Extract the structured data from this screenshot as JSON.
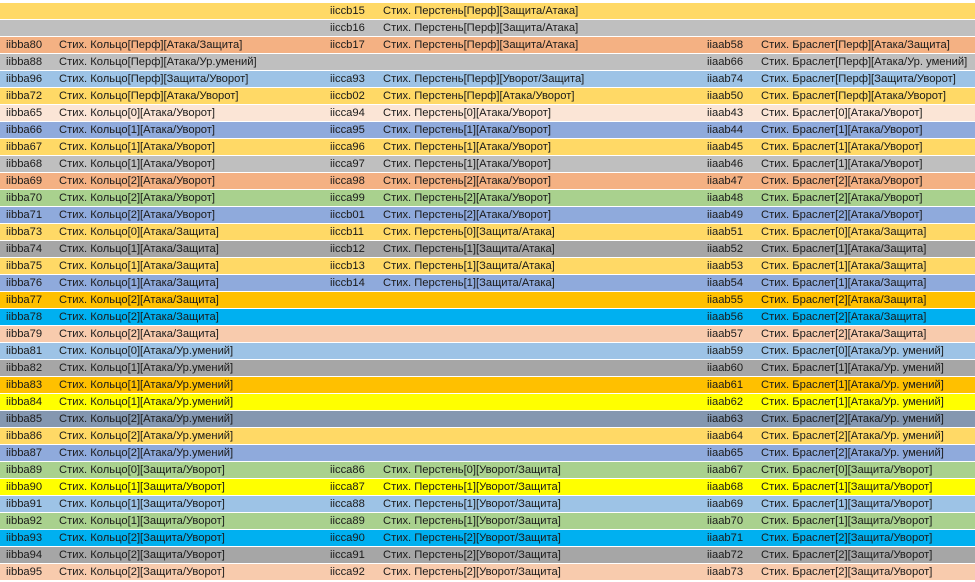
{
  "rows": [
    {
      "bg": "#ffd966",
      "c": [
        "",
        "",
        "iiccb15",
        "Стих. Перстень[Перф][Защита/Атака]",
        "",
        ""
      ]
    },
    {
      "bg": "#bfbfbf",
      "c": [
        "",
        "",
        "iiccb16",
        "Стих. Перстень[Перф][Защита/Атака]",
        "",
        ""
      ]
    },
    {
      "bg": "#f4b183",
      "c": [
        "iibba80",
        "Стих. Кольцо[Перф][Атака/Защита]",
        "iiccb17",
        "Стих. Перстень[Перф][Защита/Атака]",
        "iiaab58",
        "Стих. Браслет[Перф][Атака/Защита]"
      ]
    },
    {
      "bg": "#bfbfbf",
      "c": [
        "iibba88",
        "Стих. Кольцо[Перф][Атака/Ур.умений]",
        "",
        "",
        "iiaab66",
        "Стих. Браслет[Перф][Атака/Ур. умений]"
      ]
    },
    {
      "bg": "#9dc3e6",
      "c": [
        "iibba96",
        "Стих. Кольцо[Перф][Защита/Уворот]",
        "iicca93",
        "Стих. Перстень[Перф][Уворот/Защита]",
        "iiaab74",
        "Стих. Браслет[Перф][Защита/Уворот]"
      ]
    },
    {
      "bg": "#ffd966",
      "c": [
        "iibba72",
        "Стих. Кольцо[Перф][Атака/Уворот]",
        "iiccb02",
        "Стих. Перстень[Перф][Атака/Уворот]",
        "iiaab50",
        "Стих. Браслет[Перф][Атака/Уворот]"
      ]
    },
    {
      "bg": "#fbe5d6",
      "c": [
        "iibba65",
        "Стих. Кольцо[0][Атака/Уворот]",
        "iicca94",
        "Стих. Перстень[0][Атака/Уворот]",
        "iiaab43",
        "Стих. Браслет[0][Атака/Уворот]"
      ]
    },
    {
      "bg": "#8faadc",
      "c": [
        "iibba66",
        "Стих. Кольцо[1][Атака/Уворот]",
        "iicca95",
        "Стих. Перстень[1][Атака/Уворот]",
        "iiaab44",
        "Стих. Браслет[1][Атака/Уворот]"
      ]
    },
    {
      "bg": "#ffd966",
      "c": [
        "iibba67",
        "Стих. Кольцо[1][Атака/Уворот]",
        "iicca96",
        "Стих. Перстень[1][Атака/Уворот]",
        "iiaab45",
        "Стих. Браслет[1][Атака/Уворот]"
      ]
    },
    {
      "bg": "#bfbfbf",
      "c": [
        "iibba68",
        "Стих. Кольцо[1][Атака/Уворот]",
        "iicca97",
        "Стих. Перстень[1][Атака/Уворот]",
        "iiaab46",
        "Стих. Браслет[1][Атака/Уворот]"
      ]
    },
    {
      "bg": "#f4b183",
      "c": [
        "iibba69",
        "Стих. Кольцо[2][Атака/Уворот]",
        "iicca98",
        "Стих. Перстень[2][Атака/Уворот]",
        "iiaab47",
        "Стих. Браслет[2][Атака/Уворот]"
      ]
    },
    {
      "bg": "#a9d18e",
      "c": [
        "iibba70",
        "Стих. Кольцо[2][Атака/Уворот]",
        "iicca99",
        "Стих. Перстень[2][Атака/Уворот]",
        "iiaab48",
        "Стих. Браслет[2][Атака/Уворот]"
      ]
    },
    {
      "bg": "#8faadc",
      "c": [
        "iibba71",
        "Стих. Кольцо[2][Атака/Уворот]",
        "iiccb01",
        "Стих. Перстень[2][Атака/Уворот]",
        "iiaab49",
        "Стих. Браслет[2][Атака/Уворот]"
      ]
    },
    {
      "bg": "#ffd966",
      "c": [
        "iibba73",
        "Стих. Кольцо[0][Атака/Защита]",
        "iiccb11",
        "Стих. Перстень[0][Защита/Атака]",
        "iiaab51",
        "Стих. Браслет[0][Атака/Защита]"
      ]
    },
    {
      "bg": "#a6a6a6",
      "c": [
        "iibba74",
        "Стих. Кольцо[1][Атака/Защита]",
        "iiccb12",
        "Стих. Перстень[1][Защита/Атака]",
        "iiaab52",
        "Стих. Браслет[1][Атака/Защита]"
      ]
    },
    {
      "bg": "#ffd966",
      "c": [
        "iibba75",
        "Стих. Кольцо[1][Атака/Защита]",
        "iiccb13",
        "Стих. Перстень[1][Защита/Атака]",
        "iiaab53",
        "Стих. Браслет[1][Атака/Защита]"
      ]
    },
    {
      "bg": "#8faadc",
      "c": [
        "iibba76",
        "Стих. Кольцо[1][Атака/Защита]",
        "iiccb14",
        "Стих. Перстень[1][Защита/Атака]",
        "iiaab54",
        "Стих. Браслет[1][Атака/Защита]"
      ]
    },
    {
      "bg": "#ffc000",
      "c": [
        "iibba77",
        "Стих. Кольцо[2][Атака/Защита]",
        "",
        "",
        "iiaab55",
        "Стих. Браслет[2][Атака/Защита]"
      ]
    },
    {
      "bg": "#00b0f0",
      "c": [
        "iibba78",
        "Стих. Кольцо[2][Атака/Защита]",
        "",
        "",
        "iiaab56",
        "Стих. Браслет[2][Атака/Защита]"
      ]
    },
    {
      "bg": "#f8cbad",
      "c": [
        "iibba79",
        "Стих. Кольцо[2][Атака/Защита]",
        "",
        "",
        "iiaab57",
        "Стих. Браслет[2][Атака/Защита]"
      ]
    },
    {
      "bg": "#9dc3e6",
      "c": [
        "iibba81",
        "Стих. Кольцо[0][Атака/Ур.умений]",
        "",
        "",
        "iiaab59",
        "Стих. Браслет[0][Атака/Ур. умений]"
      ]
    },
    {
      "bg": "#a6a6a6",
      "c": [
        "iibba82",
        "Стих. Кольцо[1][Атака/Ур.умений]",
        "",
        "",
        "iiaab60",
        "Стих. Браслет[1][Атака/Ур. умений]"
      ]
    },
    {
      "bg": "#ffc000",
      "c": [
        "iibba83",
        "Стих. Кольцо[1][Атака/Ур.умений]",
        "",
        "",
        "iiaab61",
        "Стих. Браслет[1][Атака/Ур. умений]"
      ]
    },
    {
      "bg": "#ffff00",
      "c": [
        "iibba84",
        "Стих. Кольцо[1][Атака/Ур.умений]",
        "",
        "",
        "iiaab62",
        "Стих. Браслет[1][Атака/Ур. умений]"
      ]
    },
    {
      "bg": "#8497b0",
      "c": [
        "iibba85",
        "Стих. Кольцо[2][Атака/Ур.умений]",
        "",
        "",
        "iiaab63",
        "Стих. Браслет[2][Атака/Ур. умений]"
      ]
    },
    {
      "bg": "#ffd966",
      "c": [
        "iibba86",
        "Стих. Кольцо[2][Атака/Ур.умений]",
        "",
        "",
        "iiaab64",
        "Стих. Браслет[2][Атака/Ур. умений]"
      ]
    },
    {
      "bg": "#8faadc",
      "c": [
        "iibba87",
        "Стих. Кольцо[2][Атака/Ур.умений]",
        "",
        "",
        "iiaab65",
        "Стих. Браслет[2][Атака/Ур. умений]"
      ]
    },
    {
      "bg": "#a9d18e",
      "c": [
        "iibba89",
        "Стих. Кольцо[0][Защита/Уворот]",
        "iicca86",
        "Стих. Перстень[0][Уворот/Защита]",
        "iiaab67",
        "Стих. Браслет[0][Защита/Уворот]"
      ]
    },
    {
      "bg": "#ffff00",
      "c": [
        "iibba90",
        "Стих. Кольцо[1][Защита/Уворот]",
        "iicca87",
        "Стих. Перстень[1][Уворот/Защита]",
        "iiaab68",
        "Стих. Браслет[1][Защита/Уворот]"
      ]
    },
    {
      "bg": "#9dc3e6",
      "c": [
        "iibba91",
        "Стих. Кольцо[1][Защита/Уворот]",
        "iicca88",
        "Стих. Перстень[1][Уворот/Защита]",
        "iiaab69",
        "Стих. Браслет[1][Защита/Уворот]"
      ]
    },
    {
      "bg": "#a9d18e",
      "c": [
        "iibba92",
        "Стих. Кольцо[1][Защита/Уворот]",
        "iicca89",
        "Стих. Перстень[1][Уворот/Защита]",
        "iiaab70",
        "Стих. Браслет[1][Защита/Уворот]"
      ]
    },
    {
      "bg": "#00b0f0",
      "c": [
        "iibba93",
        "Стих. Кольцо[2][Защита/Уворот]",
        "iicca90",
        "Стих. Перстень[2][Уворот/Защита]",
        "iiaab71",
        "Стих. Браслет[2][Защита/Уворот]"
      ]
    },
    {
      "bg": "#a6a6a6",
      "c": [
        "iibba94",
        "Стих. Кольцо[2][Защита/Уворот]",
        "iicca91",
        "Стих. Перстень[2][Уворот/Защита]",
        "iiaab72",
        "Стих. Браслет[2][Защита/Уворот]"
      ]
    },
    {
      "bg": "#f8cbad",
      "c": [
        "iibba95",
        "Стих. Кольцо[2][Защита/Уворот]",
        "iicca92",
        "Стих. Перстень[2][Уворот/Защита]",
        "iiaab73",
        "Стих. Браслет[2][Защита/Уворот]"
      ]
    }
  ]
}
